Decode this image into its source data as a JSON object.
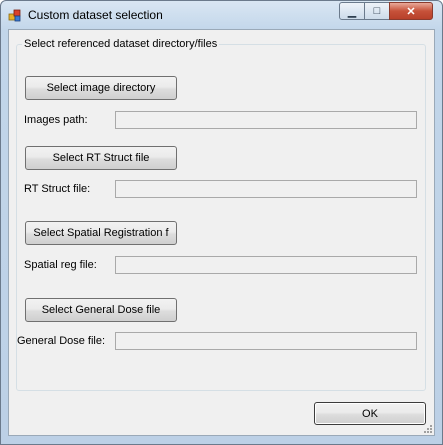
{
  "window": {
    "title": "Custom dataset selection",
    "minimize_glyph": "▁",
    "maximize_glyph": "□",
    "close_glyph": "✕"
  },
  "group": {
    "legend": "Select referenced dataset directory/files"
  },
  "images": {
    "button_label": "Select image directory",
    "path_label": "Images path:",
    "path_value": ""
  },
  "rtstruct": {
    "button_label": "Select RT Struct file",
    "path_label": "RT Struct file:",
    "path_value": ""
  },
  "spatial": {
    "button_label": "Select Spatial Registration f",
    "path_label": "Spatial reg file:",
    "path_value": ""
  },
  "dose": {
    "button_label": "Select General Dose file",
    "path_label": "General Dose file:",
    "path_value": ""
  },
  "footer": {
    "ok_label": "OK"
  }
}
